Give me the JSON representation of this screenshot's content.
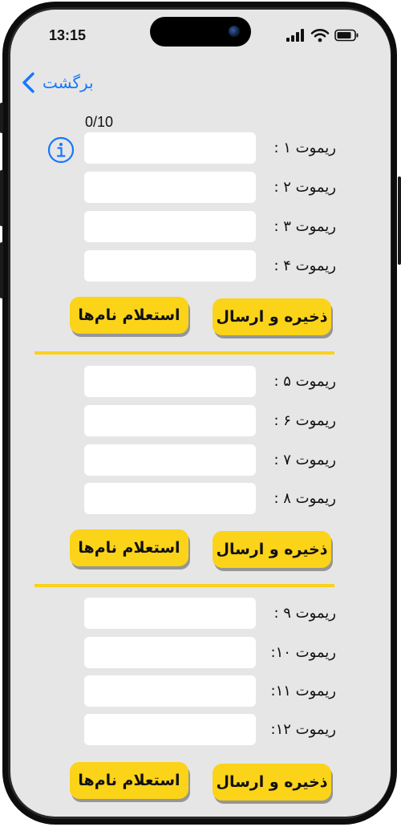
{
  "status_bar": {
    "time": "13:15"
  },
  "nav": {
    "back_label": "برگشت"
  },
  "counter": "0/10",
  "sections": [
    {
      "remotes": [
        {
          "label": "ریموت ۱ :",
          "value": ""
        },
        {
          "label": "ریموت ۲ :",
          "value": ""
        },
        {
          "label": "ریموت ۳ :",
          "value": ""
        },
        {
          "label": "ریموت ۴ :",
          "value": ""
        }
      ],
      "query_button": "استعلام نام‌ها",
      "save_button": "ذخیره و ارسال"
    },
    {
      "remotes": [
        {
          "label": "ریموت ۵ :",
          "value": ""
        },
        {
          "label": "ریموت ۶ :",
          "value": ""
        },
        {
          "label": "ریموت ۷ :",
          "value": ""
        },
        {
          "label": "ریموت ۸ :",
          "value": ""
        }
      ],
      "query_button": "استعلام نام‌ها",
      "save_button": "ذخیره و ارسال"
    },
    {
      "remotes": [
        {
          "label": "ریموت ۹ :",
          "value": ""
        },
        {
          "label": "ریموت ۱۰:",
          "value": ""
        },
        {
          "label": "ریموت ۱۱:",
          "value": ""
        },
        {
          "label": "ریموت ۱۲:",
          "value": ""
        }
      ],
      "query_button": "استعلام نام‌ها",
      "save_button": "ذخیره و ارسال"
    }
  ],
  "colors": {
    "accent": "#1677ff",
    "button_yellow": "#fbd319",
    "divider_yellow": "#fad21a",
    "background": "#e6e6e6"
  }
}
